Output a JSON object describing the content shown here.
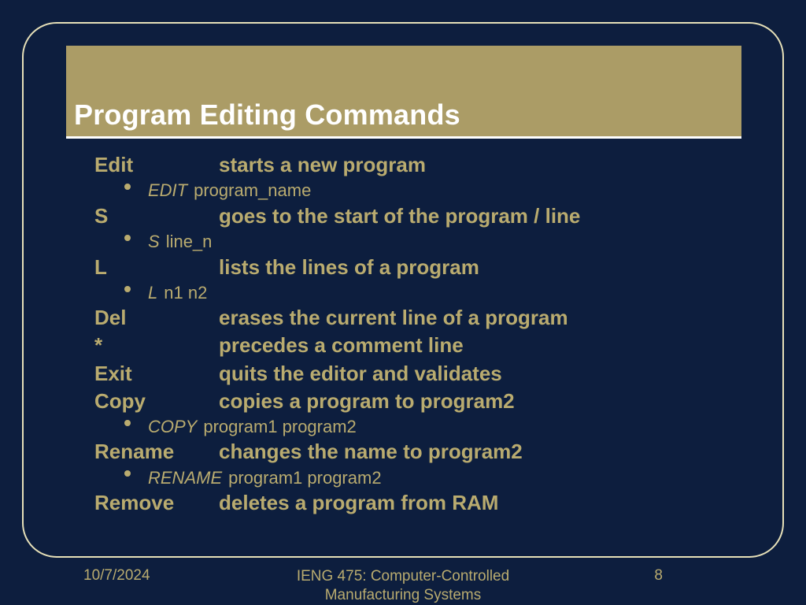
{
  "title": "Program Editing Commands",
  "commands": [
    {
      "cmd": "Edit",
      "desc": "starts a new program",
      "syntax": {
        "kw": "EDIT",
        "arg": "program_name"
      }
    },
    {
      "cmd": "S",
      "desc": "goes to the start of the program / line",
      "syntax": {
        "kw": "S",
        "arg": "line_n"
      }
    },
    {
      "cmd": "L",
      "desc": "lists the lines of a program",
      "syntax": {
        "kw": "L",
        "arg": "n1 n2"
      }
    },
    {
      "cmd": "Del",
      "desc": "erases the current line of a program"
    },
    {
      "cmd": "*",
      "desc": "precedes a comment line"
    },
    {
      "cmd": "Exit",
      "desc": "quits the editor and validates"
    },
    {
      "cmd": "Copy",
      "desc": "copies a program to program2",
      "syntax": {
        "kw": "COPY",
        "arg": "program1 program2"
      }
    },
    {
      "cmd": "Rename",
      "desc": "changes the name to program2",
      "syntax": {
        "kw": "RENAME",
        "arg": "program1 program2"
      }
    },
    {
      "cmd": "Remove",
      "desc": "deletes a program from RAM"
    }
  ],
  "footer": {
    "date": "10/7/2024",
    "course_line1": "IENG 475: Computer-Controlled",
    "course_line2": "Manufacturing Systems",
    "page": "8"
  }
}
